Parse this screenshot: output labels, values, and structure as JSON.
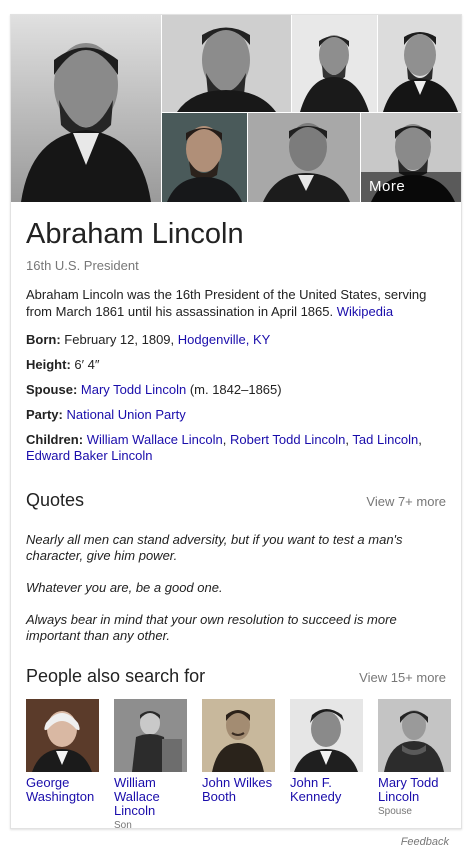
{
  "images": {
    "more_label": "More images"
  },
  "entity": {
    "title": "Abraham Lincoln",
    "subtitle": "16th U.S. President",
    "description": "Abraham Lincoln was the 16th President of the United States, serving from March 1861 until his assassination in April 1865.",
    "source_link": "Wikipedia"
  },
  "facts": {
    "born": {
      "label": "Born:",
      "text": "February 12, 1809,",
      "link": "Hodgenville, KY"
    },
    "height": {
      "label": "Height:",
      "text": "6′ 4″"
    },
    "spouse": {
      "label": "Spouse:",
      "link": "Mary Todd Lincoln",
      "text": "(m. 1842–1865)"
    },
    "party": {
      "label": "Party:",
      "link": "National Union Party"
    },
    "children": {
      "label": "Children:",
      "links": [
        "William Wallace Lincoln",
        "Robert Todd Lincoln",
        "Tad Lincoln",
        "Edward Baker Lincoln"
      ],
      "sep": ","
    }
  },
  "quotes": {
    "title": "Quotes",
    "more": "View 7+ more",
    "items": [
      "Nearly all men can stand adversity, but if you want to test a man's character, give him power.",
      "Whatever you are, be a good one.",
      "Always bear in mind that your own resolution to succeed is more important than any other."
    ]
  },
  "people": {
    "title": "People also search for",
    "more": "View 15+ more",
    "items": [
      {
        "name": "George Washington",
        "role": ""
      },
      {
        "name": "William Wallace Lincoln",
        "role": "Son"
      },
      {
        "name": "John Wilkes Booth",
        "role": ""
      },
      {
        "name": "John F. Kennedy",
        "role": ""
      },
      {
        "name": "Mary Todd Lincoln",
        "role": "Spouse"
      }
    ]
  },
  "footer": {
    "feedback": "Feedback"
  }
}
